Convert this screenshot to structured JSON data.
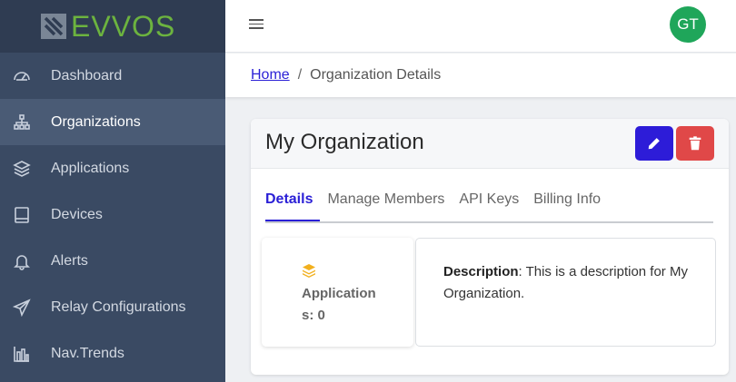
{
  "brand": {
    "name": "EVVOS"
  },
  "sidebar": {
    "items": [
      {
        "label": "Dashboard",
        "icon": "gauge-icon"
      },
      {
        "label": "Organizations",
        "icon": "sitemap-icon"
      },
      {
        "label": "Applications",
        "icon": "layers-icon"
      },
      {
        "label": "Devices",
        "icon": "tablet-icon"
      },
      {
        "label": "Alerts",
        "icon": "bell-icon"
      },
      {
        "label": "Relay Configurations",
        "icon": "paper-plane-icon"
      },
      {
        "label": "Nav.Trends",
        "icon": "bar-chart-icon"
      }
    ],
    "active_index": 1
  },
  "header": {
    "avatar_initials": "GT",
    "avatar_color": "#1fa65a"
  },
  "breadcrumb": {
    "home": "Home",
    "separator": "/",
    "current": "Organization Details"
  },
  "card": {
    "title": "My Organization",
    "edit_color": "#2d1cd8",
    "delete_color": "#e04848",
    "tabs": [
      {
        "label": "Details",
        "active": true
      },
      {
        "label": "Manage Members",
        "active": false
      },
      {
        "label": "API Keys",
        "active": false
      },
      {
        "label": "Billing Info",
        "active": false
      }
    ],
    "stat": {
      "label": "Applications: 0",
      "icon": "layers-icon",
      "icon_color": "#f2b01e"
    },
    "description": {
      "label": "Description",
      "text": ": This is a description for My Organization."
    }
  },
  "colors": {
    "sidebar_bg": "#3a4a63",
    "brand_green": "#6cb33f",
    "link": "#2a1fd6"
  }
}
